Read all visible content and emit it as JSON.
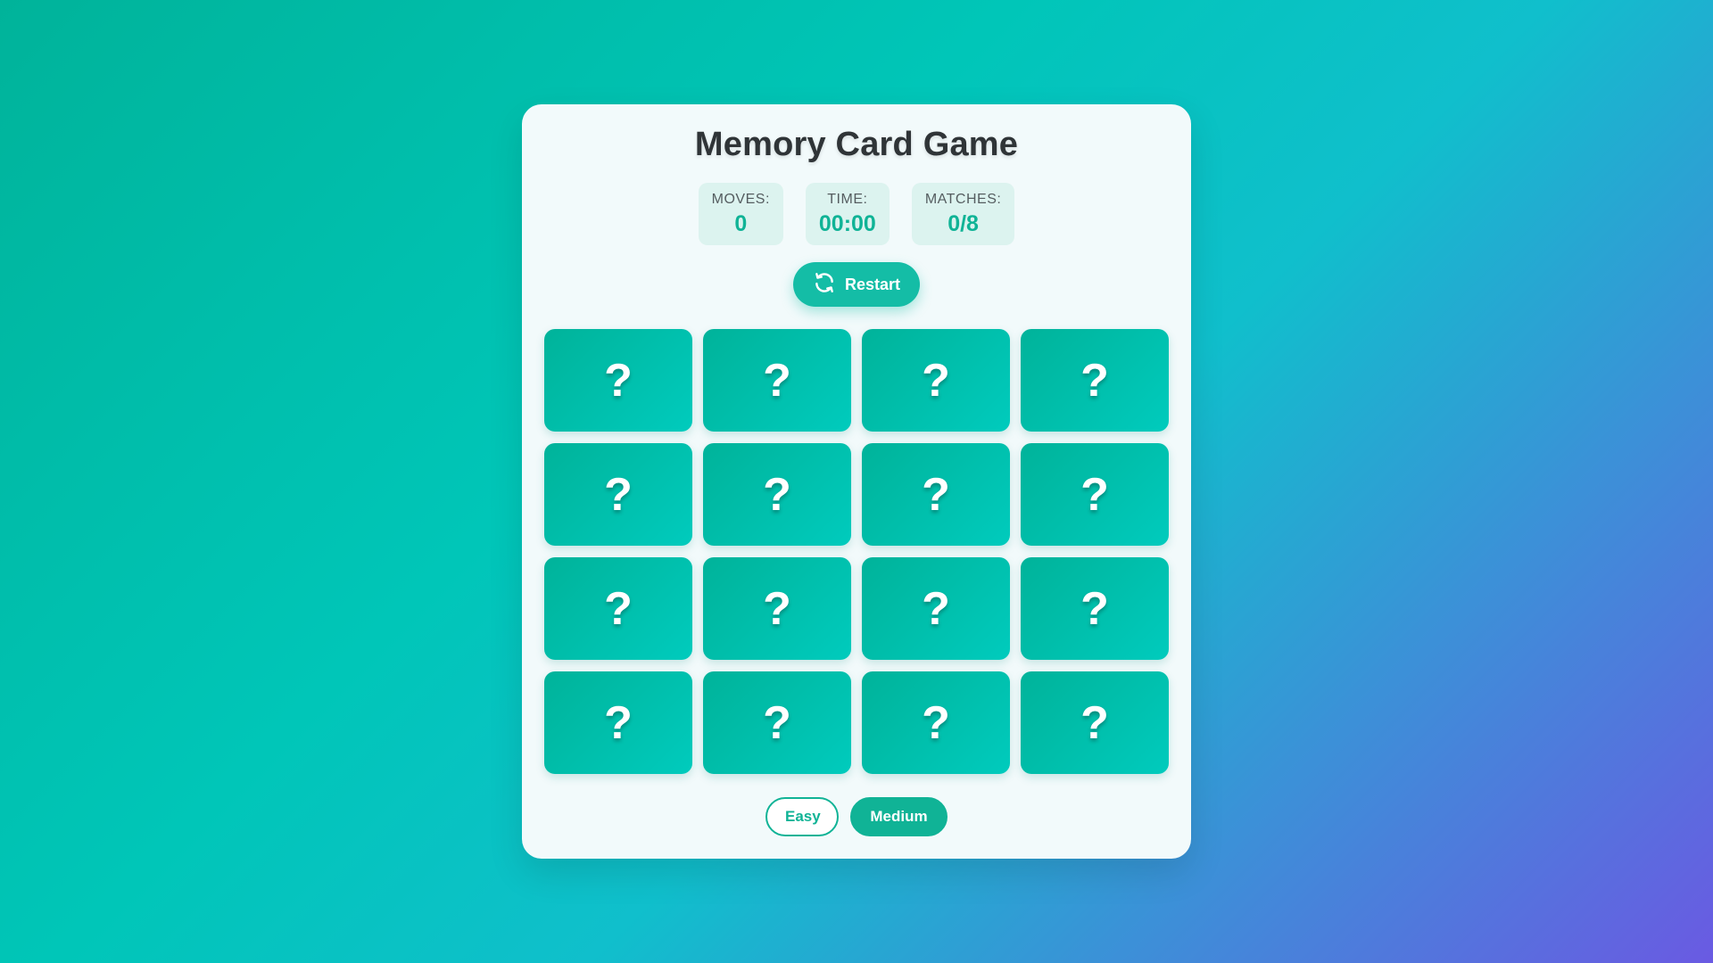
{
  "game": {
    "title": "Memory Card Game",
    "stats": [
      {
        "label": "MOVES:",
        "value": "0"
      },
      {
        "label": "TIME:",
        "value": "00:00"
      },
      {
        "label": "MATCHES:",
        "value": "0/8"
      }
    ],
    "restart_label": "Restart",
    "restart_icon": "refresh-icon",
    "card_back_glyph": "?",
    "cards": [
      {
        "face": "?"
      },
      {
        "face": "?"
      },
      {
        "face": "?"
      },
      {
        "face": "?"
      },
      {
        "face": "?"
      },
      {
        "face": "?"
      },
      {
        "face": "?"
      },
      {
        "face": "?"
      },
      {
        "face": "?"
      },
      {
        "face": "?"
      },
      {
        "face": "?"
      },
      {
        "face": "?"
      },
      {
        "face": "?"
      },
      {
        "face": "?"
      },
      {
        "face": "?"
      },
      {
        "face": "?"
      }
    ],
    "difficulty": [
      {
        "label": "Easy",
        "selected": false
      },
      {
        "label": "Medium",
        "selected": true
      }
    ]
  },
  "colors": {
    "accent": "#10b396",
    "card_start": "#00b39a",
    "card_end": "#00cbbd",
    "background_start": "#00b39a",
    "background_end": "#6a5ae2"
  }
}
